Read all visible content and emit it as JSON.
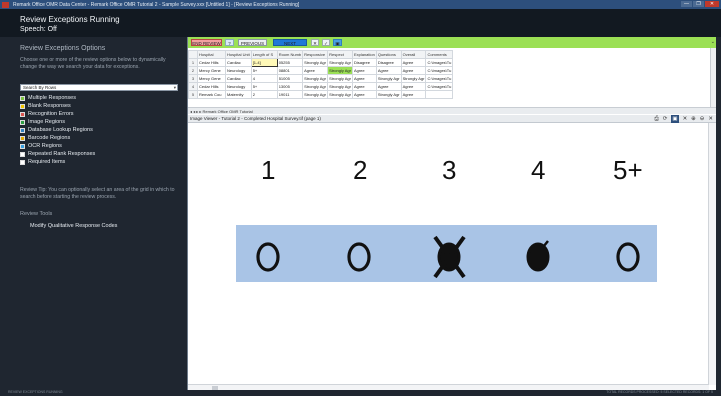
{
  "window": {
    "title": "Remark Office OMR Data Center - Remark Office OMR Tutorial 2 - Sample Survey.xxx [Untitled 1] - [Review Exceptions Running]",
    "buttons": [
      "—",
      "❐",
      "✕"
    ]
  },
  "header": {
    "title": "Review Exceptions Running",
    "speech": "Speech: Off"
  },
  "sidebar": {
    "section_title": "Review Exceptions Options",
    "description": "Choose one or more of the review options below to dynamically change the way we search your data for exceptions.",
    "search_by": "Search By Rows",
    "options": [
      {
        "label": "Multiple Responses",
        "color": "#7dc242"
      },
      {
        "label": "Blank Responses",
        "color": "#f2c500"
      },
      {
        "label": "Recognition Errors",
        "color": "#d9534f"
      },
      {
        "label": "Image Regions",
        "color": "#2f9e44"
      },
      {
        "label": "Database Lookup Regions",
        "color": "#2f7fbf"
      },
      {
        "label": "Barcode Regions",
        "color": "#e0a800"
      },
      {
        "label": "OCR Regions",
        "color": "#3aa0e0"
      },
      {
        "label": "Repeated Rank Responses",
        "color": "#ffffff"
      },
      {
        "label": "Required Items",
        "color": "#ffffff"
      }
    ],
    "tip": "Review Tip: You can optionally select an area of the grid in which to search before starting the review process.",
    "tools_title": "Review Tools",
    "tools": [
      "Modify Qualitative Response Codes"
    ]
  },
  "toolbar": {
    "end_review": "END REVIEW",
    "help": "?",
    "previous": "PREVIOUS",
    "next": "NEXT",
    "reject": "✕",
    "accept": "✓",
    "image": "▣",
    "collapse": "⌄"
  },
  "grid": {
    "columns": [
      "",
      "Hospital",
      "Hospital Unit",
      "Length of S",
      "Room Numb",
      "Responsive",
      "Respect",
      "Explanation",
      "Questions",
      "Overall",
      "Comments"
    ],
    "rows": [
      [
        "1",
        "Cedar Hills",
        "Cardiac",
        "[1-4]",
        "05255",
        "Strongly Agr",
        "Strongly Agr",
        "Disagree",
        "Disagree",
        "Agree",
        "C:\\Images\\Tu"
      ],
      [
        "2",
        "Mercy Gene",
        "Neurology",
        "5+",
        "08801",
        "Agree",
        "Strongly Agr",
        "Agree",
        "Agree",
        "Agree",
        "C:\\Images\\Tu"
      ],
      [
        "3",
        "Mercy Gene",
        "Cardiac",
        "4",
        "51005",
        "Strongly Agr",
        "Strongly Agr",
        "Agree",
        "Strongly Agr",
        "Strongly Agr",
        "C:\\Images\\Tu"
      ],
      [
        "4",
        "Cedar Hills",
        "Neurology",
        "5+",
        "13005",
        "Strongly Agr",
        "Strongly Agr",
        "Agree",
        "Agree",
        "Agree",
        "C:\\Images\\Tu"
      ],
      [
        "5",
        "Remark Cou",
        "Maternity",
        "2",
        "19011",
        "Strongly Agr",
        "Strongly Agr",
        "Agree",
        "Strongly Agr",
        "Agree",
        ""
      ]
    ],
    "sheet_tab": "Remark Office OMR Tutorial"
  },
  "image_viewer": {
    "title": "Image Viewer - Tutorial 2 - Completed Hospital Survey.tif (page 1)",
    "header_icons": [
      "⎙",
      "⟳",
      "▣",
      "✕",
      "⊕",
      "⊖",
      "✕"
    ],
    "numbers": [
      "1",
      "2",
      "3",
      "4",
      "5+"
    ],
    "bubble_states": [
      "empty",
      "empty",
      "crossed",
      "filled",
      "empty"
    ]
  },
  "statusbar": {
    "left": "REVIEW EXCEPTIONS RUNNING",
    "right": "TOTAL RECORDS PROCESSED: 5    SELECTED RECORDS: 1 OF 5"
  }
}
